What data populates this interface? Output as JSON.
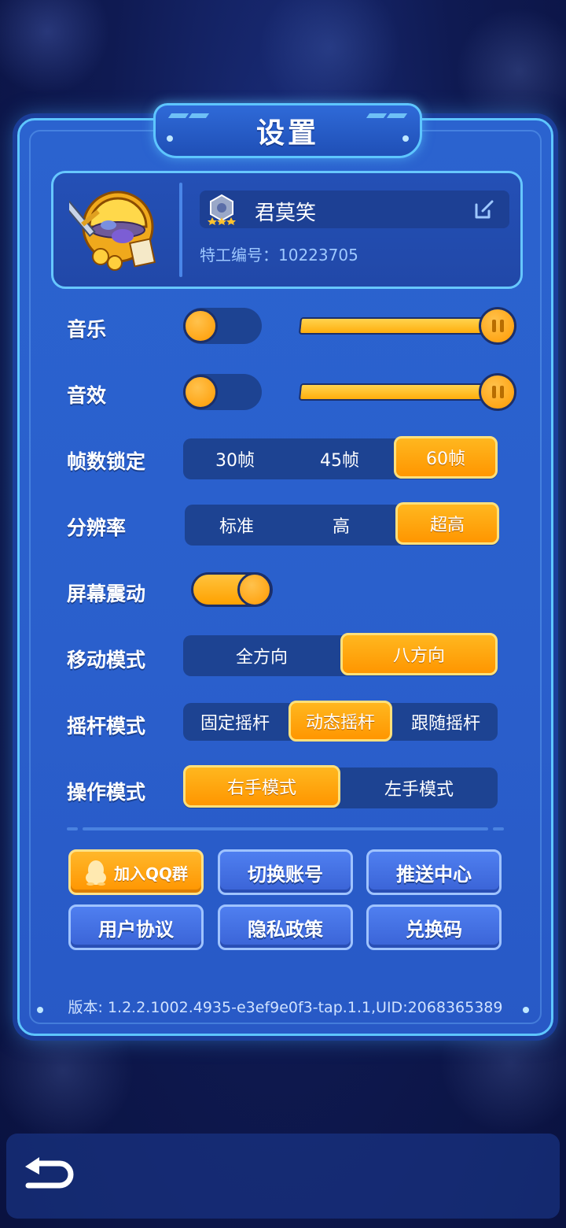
{
  "title": "设置",
  "profile": {
    "name": "君莫笑",
    "agent_id": "特工编号：10223705"
  },
  "settings": {
    "music_label": "音乐",
    "sfx_label": "音效",
    "music_volume": 1.0,
    "sfx_volume": 1.0,
    "fps_label": "帧数锁定",
    "fps_options": [
      "30帧",
      "45帧",
      "60帧"
    ],
    "fps_selected": "60帧",
    "resolution_label": "分辨率",
    "resolution_options": [
      "标准",
      "高",
      "超高"
    ],
    "resolution_selected": "超高",
    "shake_label": "屏幕震动",
    "move_label": "移动模式",
    "move_options": [
      "全方向",
      "八方向"
    ],
    "move_selected": "八方向",
    "joystick_label": "摇杆模式",
    "joystick_options": [
      "固定摇杆",
      "动态摇杆",
      "跟随摇杆"
    ],
    "joystick_selected": "动态摇杆",
    "control_label": "操作模式",
    "control_options": [
      "右手模式",
      "左手模式"
    ],
    "control_selected": "右手模式"
  },
  "buttons": {
    "join_qq": "加入QQ群",
    "switch_account": "切换账号",
    "push_center": "推送中心",
    "user_agreement": "用户协议",
    "privacy_policy": "隐私政策",
    "redeem_code": "兑换码"
  },
  "version": "版本: 1.2.2.1002.4935-e3ef9e0f3-tap.1.1,UID:2068365389",
  "colors": {
    "accent": "#ff9f0a",
    "panel": "#2b63cf",
    "border": "#5ec6ff"
  },
  "icons": [
    "rank-star-icon",
    "edit-icon",
    "qq-penguin-icon",
    "back-arrow-icon",
    "pause-icon"
  ]
}
